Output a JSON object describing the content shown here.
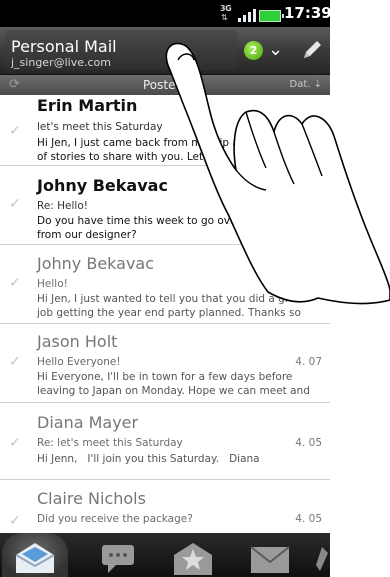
{
  "status": {
    "network": "3G",
    "arrows": "⇅",
    "time": "17:39"
  },
  "header": {
    "title": "Personal Mail",
    "email": "j_singer@live.com",
    "unread_count": "2"
  },
  "folder_bar": {
    "label": "Posteing",
    "sort_label": "Dat. ⇣"
  },
  "emails": [
    {
      "sender": "Erin Martin",
      "subject": "let's meet this Saturday",
      "preview": "Hi Jen, I just came back from my trip and I have lots of stories to share with you. Let's h",
      "date": "",
      "unread": true
    },
    {
      "sender": "Johny Bekavac",
      "subject": "Re: Hello!",
      "preview": "Do you have time this week to go over the design from our designer?",
      "date": "",
      "unread": true
    },
    {
      "sender": "Johny Bekavac",
      "subject": "Hello!",
      "preview": "Hi Jen, I just wanted to tell you that you did a great job getting the year end party planned. Thanks so",
      "date": "",
      "unread": false
    },
    {
      "sender": "Jason Holt",
      "subject": "Hello Everyone!",
      "preview": "Hi Everyone, I'll be in town for a few days before leaving to Japan on Monday. Hope we can meet and",
      "date": "4. 07",
      "unread": false
    },
    {
      "sender": "Diana Mayer",
      "subject": "Re: let's meet this Saturday",
      "preview": "Hi Jenn,   I'll join you this Saturday.   Diana",
      "date": "4. 05",
      "unread": false
    },
    {
      "sender": "Claire Nichols",
      "subject": "Did you receive the package?",
      "preview": "",
      "date": "4. 05",
      "unread": false
    }
  ],
  "tabs": [
    {
      "icon": "inbox-envelope-icon"
    },
    {
      "icon": "conversations-icon"
    },
    {
      "icon": "vip-star-icon"
    },
    {
      "icon": "unread-envelope-icon"
    },
    {
      "icon": "more-icon"
    }
  ]
}
